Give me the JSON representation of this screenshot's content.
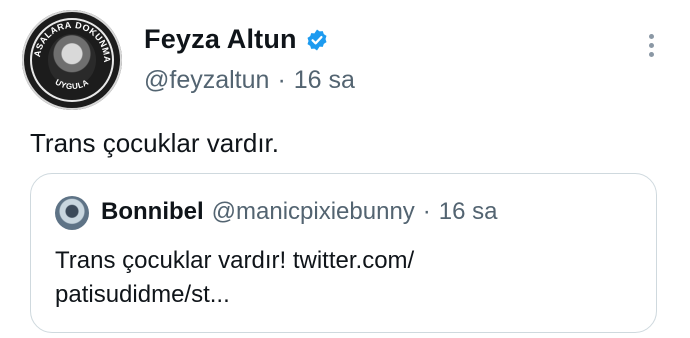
{
  "author": {
    "display_name": "Feyza Altun",
    "handle": "@feyzaltun",
    "time": "16 sa",
    "avatar_logo_text_top": "YASALARA DOKUNMA",
    "avatar_logo_text_bottom": "UYGULA",
    "verified_color": "#1d9bf0"
  },
  "tweet": {
    "text": "Trans çocuklar vardır."
  },
  "quote": {
    "display_name": "Bonnibel",
    "handle": "@manicpixiebunny",
    "time": "16 sa",
    "text_line1": "Trans çocuklar vardır! twitter.com/",
    "text_line2": "patisudidme/st..."
  },
  "separator": "·",
  "icons": {
    "verified": "verified-badge-icon",
    "more": "more-options-icon"
  }
}
